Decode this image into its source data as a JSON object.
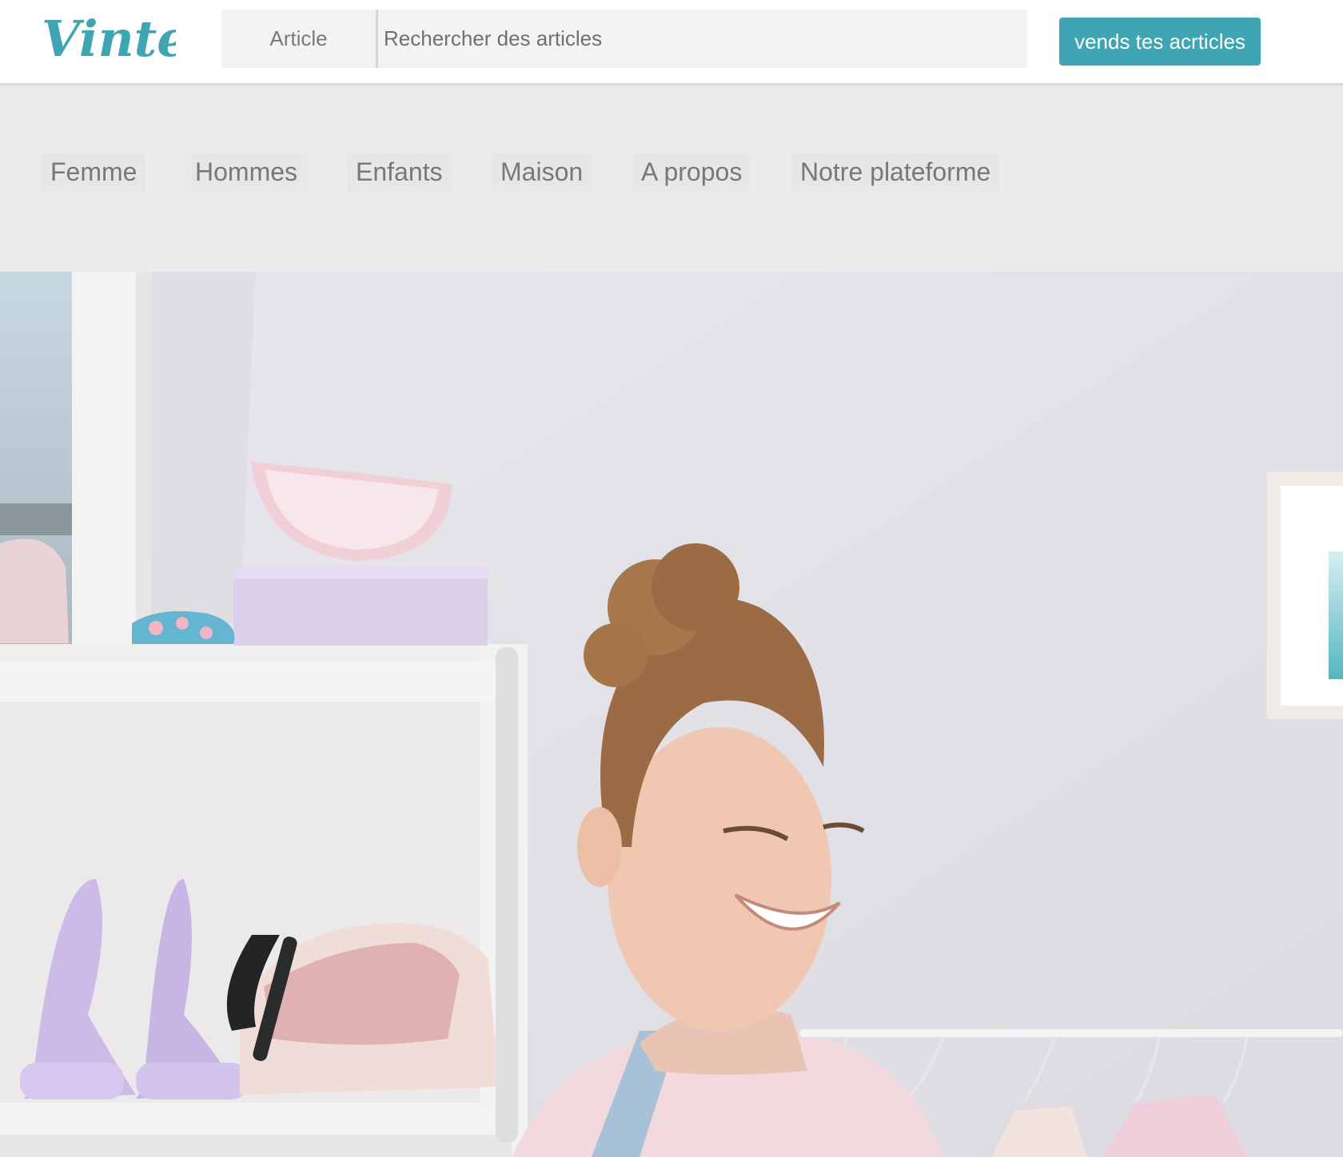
{
  "brand": {
    "logo_text": "Vinted",
    "color": "#3fa5b2"
  },
  "search": {
    "category": "Article",
    "placeholder": "Rechercher des articles"
  },
  "header": {
    "sell_button": "vends tes acrticles"
  },
  "nav": {
    "items": [
      {
        "label": "Femme"
      },
      {
        "label": "Hommes"
      },
      {
        "label": "Enfants"
      },
      {
        "label": "Maison"
      },
      {
        "label": "A propos"
      },
      {
        "label": "Notre plateforme"
      }
    ]
  },
  "hero": {
    "image": "woman-smiling-wardrobe-photo"
  }
}
